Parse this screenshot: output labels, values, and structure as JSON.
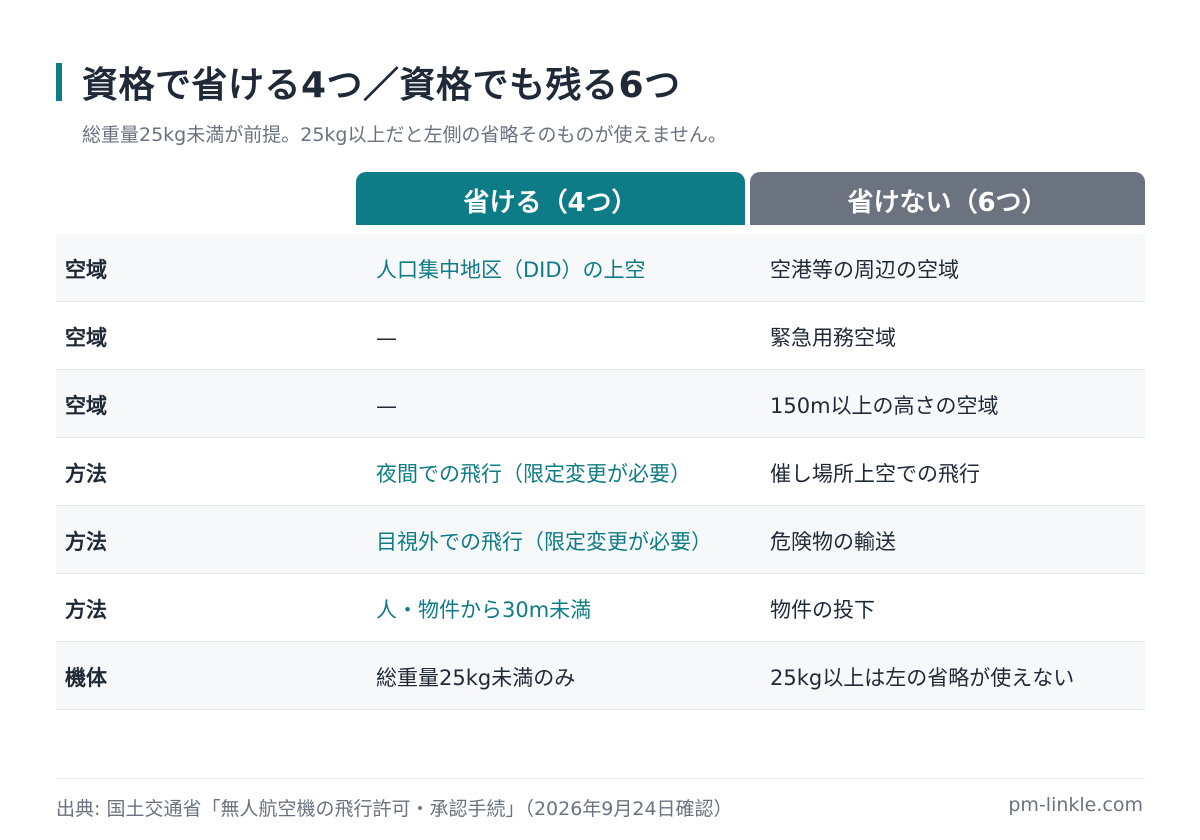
{
  "title": "資格で省ける4つ／資格でも残る6つ",
  "subtitle": "総重量25kg未満が前提。25kg以上だと左側の省略そのものが使えません。",
  "columns": {
    "can_skip": "省ける（4つ）",
    "cannot_skip": "省けない（6つ）"
  },
  "rows": [
    {
      "category": "空域",
      "can_skip": "人口集中地区（DID）の上空",
      "can_skip_style": "teal",
      "cannot_skip": "空港等の周辺の空域"
    },
    {
      "category": "空域",
      "can_skip": "—",
      "can_skip_style": "plain",
      "cannot_skip": "緊急用務空域"
    },
    {
      "category": "空域",
      "can_skip": "—",
      "can_skip_style": "plain",
      "cannot_skip": "150m以上の高さの空域"
    },
    {
      "category": "方法",
      "can_skip": "夜間での飛行（限定変更が必要）",
      "can_skip_style": "teal",
      "cannot_skip": "催し場所上空での飛行"
    },
    {
      "category": "方法",
      "can_skip": "目視外での飛行（限定変更が必要）",
      "can_skip_style": "teal",
      "cannot_skip": "危険物の輸送"
    },
    {
      "category": "方法",
      "can_skip": "人・物件から30m未満",
      "can_skip_style": "teal",
      "cannot_skip": "物件の投下"
    },
    {
      "category": "機体",
      "can_skip": "総重量25kg未満のみ",
      "can_skip_style": "plain",
      "cannot_skip": "25kg以上は左の省略が使えない"
    }
  ],
  "footer": {
    "source": "出典: 国土交通省「無人航空機の飛行許可・承認手続」（2026年9月24日確認）",
    "site": "pm-linkle.com"
  },
  "colors": {
    "accent": "#0e7c86",
    "muted_header": "#6b7280",
    "text": "#1f2937",
    "row_alt": "#f7f8f9"
  }
}
